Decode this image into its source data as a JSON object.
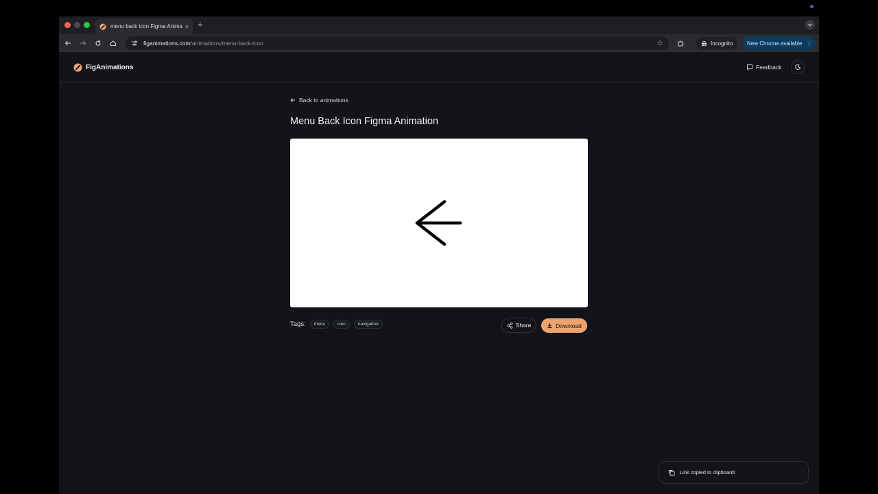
{
  "browser": {
    "tab_title": "menu back icon Figma Anima",
    "tab_close": "×",
    "new_tab": "+",
    "url_host": "figanimations.com",
    "url_path": "/animations/menu-back-icon",
    "incognito_label": "Incognito",
    "update_label": "New Chrome available"
  },
  "site": {
    "brand": "FigAnimations",
    "feedback_label": "Feedback",
    "accent_color": "#efa470"
  },
  "main": {
    "back_link": "Back to animations",
    "title": "Menu Back Icon Figma Animation",
    "tags_label": "Tags:",
    "tags": [
      "menu",
      "icon",
      "navigation"
    ],
    "share_label": "Share",
    "download_label": "Download"
  },
  "toast": {
    "message": "Link copied to clipboard!"
  }
}
